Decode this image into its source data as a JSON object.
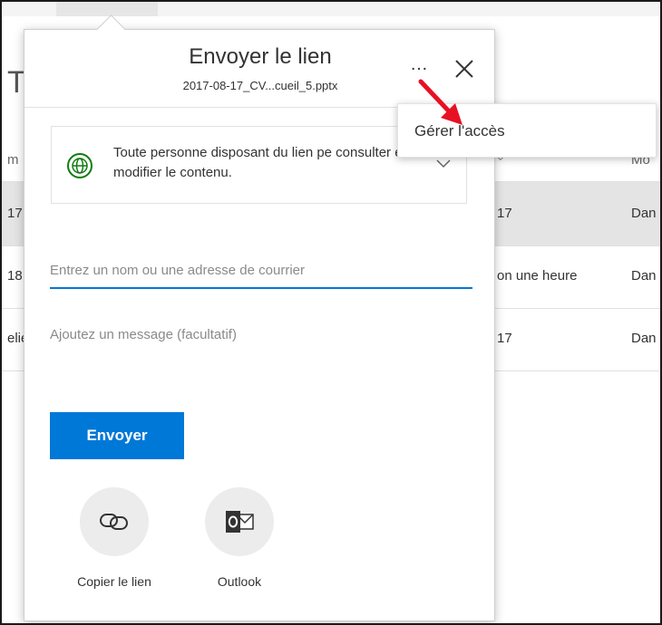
{
  "background": {
    "title_partial": "T",
    "header": {
      "col1": "m",
      "col2": "⌄",
      "col3": "Mo"
    },
    "rows": [
      {
        "col1": "17",
        "col2": "17",
        "col3": "Dan"
      },
      {
        "col1": "18",
        "col2": "on une heure",
        "col3": "Dan"
      },
      {
        "col1": "elie",
        "col2": "17",
        "col3": "Dan"
      }
    ]
  },
  "dialog": {
    "title": "Envoyer le lien",
    "filename": "2017-08-17_CV...cueil_5.pptx",
    "more_label": "…",
    "permission_text": "Toute personne disposant du lien pe consulter et modifier le contenu.",
    "name_placeholder": "Entrez un nom ou une adresse de courrier",
    "message_placeholder": "Ajoutez un message (facultatif)",
    "send_label": "Envoyer",
    "share_options": [
      {
        "label": "Copier le lien",
        "icon": "link-icon"
      },
      {
        "label": "Outlook",
        "icon": "outlook-icon"
      }
    ]
  },
  "context_menu": {
    "items": [
      {
        "label": "Gérer l'accès"
      }
    ]
  },
  "colors": {
    "accent": "#0078d7",
    "globe": "#107c10",
    "arrow": "#e81123",
    "outlook": "#0072c6"
  }
}
